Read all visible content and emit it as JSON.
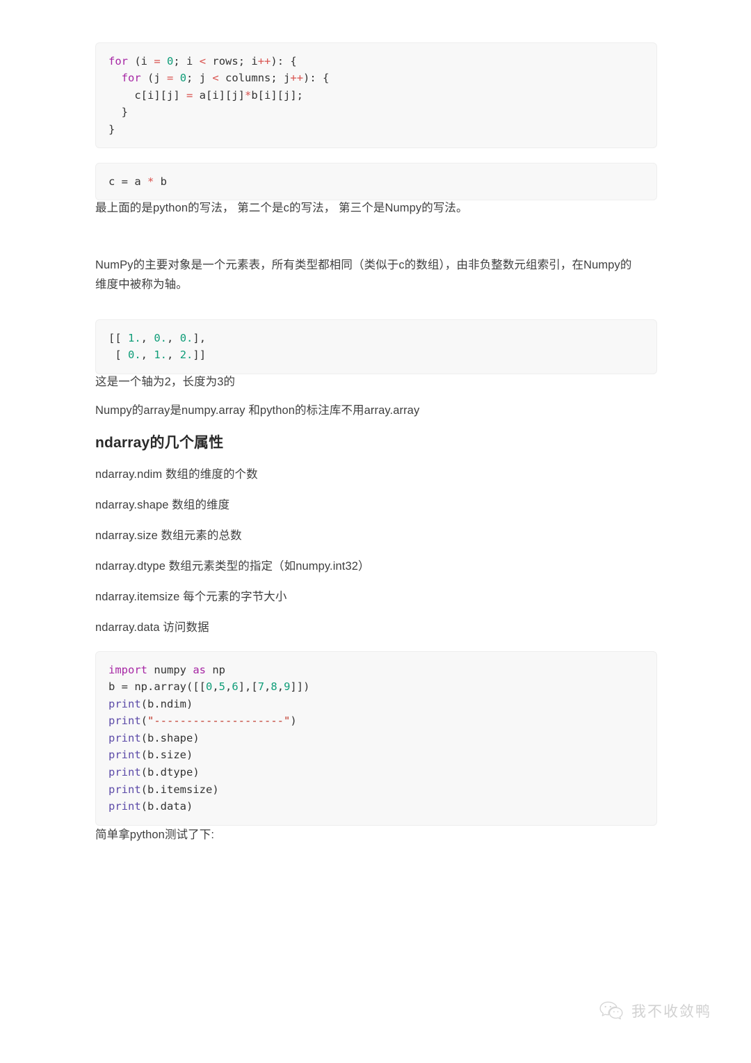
{
  "document": {
    "code_block_c_loop": {
      "lines": [
        [
          {
            "t": "for",
            "c": "kw"
          },
          {
            "t": " (i ",
            "c": "pl"
          },
          {
            "t": "=",
            "c": "op"
          },
          {
            "t": " ",
            "c": "pl"
          },
          {
            "t": "0",
            "c": "num"
          },
          {
            "t": "; i ",
            "c": "pl"
          },
          {
            "t": "<",
            "c": "op"
          },
          {
            "t": " rows; i",
            "c": "pl"
          },
          {
            "t": "++",
            "c": "op"
          },
          {
            "t": "): {",
            "c": "pl"
          }
        ],
        [
          {
            "t": "  ",
            "c": "pl"
          },
          {
            "t": "for",
            "c": "kw"
          },
          {
            "t": " (j ",
            "c": "pl"
          },
          {
            "t": "=",
            "c": "op"
          },
          {
            "t": " ",
            "c": "pl"
          },
          {
            "t": "0",
            "c": "num"
          },
          {
            "t": "; j ",
            "c": "pl"
          },
          {
            "t": "<",
            "c": "op"
          },
          {
            "t": " columns; j",
            "c": "pl"
          },
          {
            "t": "++",
            "c": "op"
          },
          {
            "t": "): {",
            "c": "pl"
          }
        ],
        [
          {
            "t": "    c[i][j] ",
            "c": "pl"
          },
          {
            "t": "=",
            "c": "op"
          },
          {
            "t": " a[i][j]",
            "c": "pl"
          },
          {
            "t": "*",
            "c": "op"
          },
          {
            "t": "b[i][j];",
            "c": "pl"
          }
        ],
        [
          {
            "t": "  }",
            "c": "pl"
          }
        ],
        [
          {
            "t": "}",
            "c": "pl"
          }
        ]
      ],
      "plain_text": "for (i = 0; i < rows; i++): {\n  for (j = 0; j < columns; j++): {\n    c[i][j] = a[i][j]*b[i][j];\n  }\n}"
    },
    "code_block_numpy_mult": {
      "lines": [
        [
          {
            "t": "c = a ",
            "c": "pl"
          },
          {
            "t": "*",
            "c": "op"
          },
          {
            "t": " b",
            "c": "pl"
          }
        ]
      ],
      "plain_text": "c = a * b"
    },
    "para_writing_styles": "最上面的是python的写法， 第二个是c的写法， 第三个是Numpy的写法。",
    "para_numpy_main_object": "NumPy的主要对象是一个元素表，所有类型都相同（类似于c的数组），由非负整数元组索引，在Numpy的维度中被称为轴。",
    "code_block_array_literal": {
      "lines": [
        [
          {
            "t": "[[ ",
            "c": "pl"
          },
          {
            "t": "1.",
            "c": "num"
          },
          {
            "t": ", ",
            "c": "pl"
          },
          {
            "t": "0.",
            "c": "num"
          },
          {
            "t": ", ",
            "c": "pl"
          },
          {
            "t": "0.",
            "c": "num"
          },
          {
            "t": "],",
            "c": "pl"
          }
        ],
        [
          {
            "t": " [ ",
            "c": "pl"
          },
          {
            "t": "0.",
            "c": "num"
          },
          {
            "t": ", ",
            "c": "pl"
          },
          {
            "t": "1.",
            "c": "num"
          },
          {
            "t": ", ",
            "c": "pl"
          },
          {
            "t": "2.",
            "c": "num"
          },
          {
            "t": "]]",
            "c": "pl"
          }
        ]
      ],
      "plain_text": "[[ 1., 0., 0.],\n [ 0., 1., 2.]]"
    },
    "para_axis_desc": "这是一个轴为2，长度为3的",
    "para_array_lib": "Numpy的array是numpy.array 和python的标注库不用array.array",
    "heading_ndarray_attrs": "ndarray的几个属性",
    "attributes": [
      "ndarray.ndim 数组的维度的个数",
      "ndarray.shape 数组的维度",
      "ndarray.size 数组元素的总数",
      "ndarray.dtype 数组元素类型的指定（如numpy.int32）",
      "ndarray.itemsize 每个元素的字节大小",
      "ndarray.data 访问数据"
    ],
    "code_block_python_demo": {
      "lines": [
        [
          {
            "t": "import",
            "c": "kw"
          },
          {
            "t": " numpy ",
            "c": "pl"
          },
          {
            "t": "as",
            "c": "kw"
          },
          {
            "t": " np",
            "c": "pl"
          }
        ],
        [
          {
            "t": "b = np.array([[",
            "c": "pl"
          },
          {
            "t": "0",
            "c": "num"
          },
          {
            "t": ",",
            "c": "pl"
          },
          {
            "t": "5",
            "c": "num"
          },
          {
            "t": ",",
            "c": "pl"
          },
          {
            "t": "6",
            "c": "num"
          },
          {
            "t": "],[",
            "c": "pl"
          },
          {
            "t": "7",
            "c": "num"
          },
          {
            "t": ",",
            "c": "pl"
          },
          {
            "t": "8",
            "c": "num"
          },
          {
            "t": ",",
            "c": "pl"
          },
          {
            "t": "9",
            "c": "num"
          },
          {
            "t": "]])",
            "c": "pl"
          }
        ],
        [
          {
            "t": "print",
            "c": "fn"
          },
          {
            "t": "(b.ndim)",
            "c": "pl"
          }
        ],
        [
          {
            "t": "print",
            "c": "fn"
          },
          {
            "t": "(",
            "c": "pl"
          },
          {
            "t": "\"--------------------\"",
            "c": "str"
          },
          {
            "t": ")",
            "c": "pl"
          }
        ],
        [
          {
            "t": "print",
            "c": "fn"
          },
          {
            "t": "(b.shape)",
            "c": "pl"
          }
        ],
        [
          {
            "t": "print",
            "c": "fn"
          },
          {
            "t": "(b.size)",
            "c": "pl"
          }
        ],
        [
          {
            "t": "print",
            "c": "fn"
          },
          {
            "t": "(b.dtype)",
            "c": "pl"
          }
        ],
        [
          {
            "t": "print",
            "c": "fn"
          },
          {
            "t": "(b.itemsize)",
            "c": "pl"
          }
        ],
        [
          {
            "t": "print",
            "c": "fn"
          },
          {
            "t": "(b.data)",
            "c": "pl"
          }
        ]
      ],
      "plain_text": "import numpy as np\nb = np.array([[0,5,6],[7,8,9]])\nprint(b.ndim)\nprint(\"--------------------\")\nprint(b.shape)\nprint(b.size)\nprint(b.dtype)\nprint(b.itemsize)\nprint(b.data)"
    },
    "para_test_note": "简单拿python测试了下:"
  },
  "watermark": {
    "text": "我不收敛鸭",
    "icon": "wechat-logo",
    "color": "#cfcfcf"
  },
  "colors": {
    "code_bg": "#f8f8f8",
    "code_border": "#eeeeee",
    "text": "#3f3f3f",
    "keyword": "#a626a4",
    "number": "#0f9d78",
    "operator": "#d9534f",
    "function": "#5c4ba8",
    "string": "#c0392b"
  }
}
